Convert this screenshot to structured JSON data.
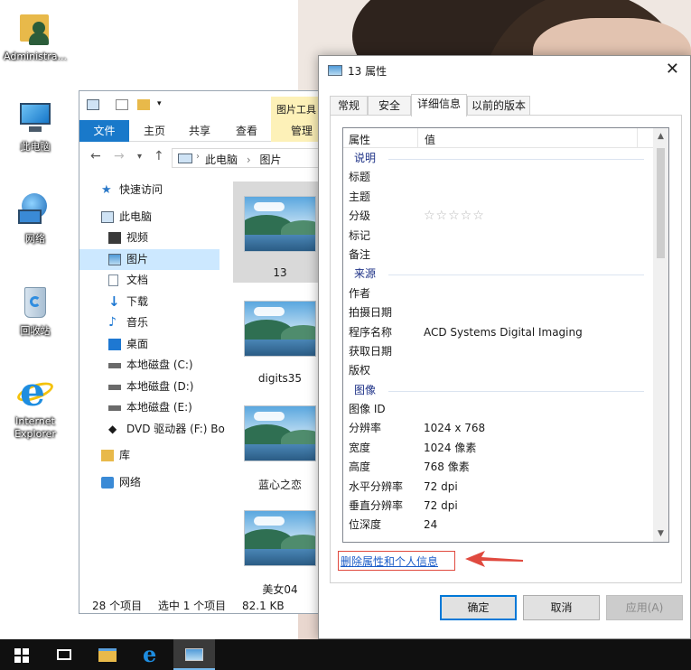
{
  "desktop": {
    "icons": [
      {
        "label": "Administra...",
        "icon": "user-folder-icon"
      },
      {
        "label": "此电脑",
        "icon": "computer-icon"
      },
      {
        "label": "网络",
        "icon": "network-icon"
      },
      {
        "label": "回收站",
        "icon": "recycle-bin-icon"
      },
      {
        "label": "Internet Explorer",
        "icon": "internet-explorer-icon"
      }
    ]
  },
  "explorer": {
    "context_tab": "图片工具",
    "ribbon_tabs": [
      "文件",
      "主页",
      "共享",
      "查看",
      "管理"
    ],
    "breadcrumb": [
      "此电脑",
      "图片"
    ],
    "nav_items": [
      {
        "label": "快速访问",
        "icon": "star-icon"
      },
      {
        "label": "此电脑",
        "icon": "computer-icon"
      },
      {
        "label": "视频",
        "icon": "video-icon"
      },
      {
        "label": "图片",
        "icon": "pictures-icon"
      },
      {
        "label": "文档",
        "icon": "document-icon"
      },
      {
        "label": "下载",
        "icon": "download-icon"
      },
      {
        "label": "音乐",
        "icon": "music-icon"
      },
      {
        "label": "桌面",
        "icon": "desktop-icon"
      },
      {
        "label": "本地磁盘 (C:)",
        "icon": "drive-icon"
      },
      {
        "label": "本地磁盘 (D:)",
        "icon": "drive-icon"
      },
      {
        "label": "本地磁盘 (E:)",
        "icon": "drive-icon"
      },
      {
        "label": "DVD 驱动器 (F:) Bo",
        "icon": "dvd-icon"
      },
      {
        "label": "库",
        "icon": "library-icon"
      },
      {
        "label": "网络",
        "icon": "network-icon"
      }
    ],
    "files": [
      "13",
      "digits35",
      "蓝心之恋",
      "美女04"
    ],
    "status": {
      "count": "28 个项目",
      "selected": "选中 1 个项目",
      "size": "82.1 KB"
    }
  },
  "dialog": {
    "title": "13 属性",
    "tabs": [
      "常规",
      "安全",
      "详细信息",
      "以前的版本"
    ],
    "active_tab": "详细信息",
    "columns": {
      "property": "属性",
      "value": "值"
    },
    "rows": [
      {
        "group": "说明"
      },
      {
        "key": "标题",
        "value": ""
      },
      {
        "key": "主题",
        "value": ""
      },
      {
        "key": "分级",
        "value": "☆☆☆☆☆"
      },
      {
        "key": "标记",
        "value": ""
      },
      {
        "key": "备注",
        "value": ""
      },
      {
        "group": "来源"
      },
      {
        "key": "作者",
        "value": ""
      },
      {
        "key": "拍摄日期",
        "value": ""
      },
      {
        "key": "程序名称",
        "value": "ACD Systems Digital Imaging"
      },
      {
        "key": "获取日期",
        "value": ""
      },
      {
        "key": "版权",
        "value": ""
      },
      {
        "group": "图像"
      },
      {
        "key": "图像 ID",
        "value": ""
      },
      {
        "key": "分辨率",
        "value": "1024 x 768"
      },
      {
        "key": "宽度",
        "value": "1024 像素"
      },
      {
        "key": "高度",
        "value": "768 像素"
      },
      {
        "key": "水平分辨率",
        "value": "72 dpi"
      },
      {
        "key": "垂直分辨率",
        "value": "72 dpi"
      },
      {
        "key": "位深度",
        "value": "24"
      }
    ],
    "remove_link": "删除属性和个人信息",
    "buttons": {
      "ok": "确定",
      "cancel": "取消",
      "apply": "应用(A)"
    }
  },
  "taskbar": {
    "items": [
      "start-icon",
      "task-view-icon",
      "file-explorer-icon",
      "internet-explorer-icon",
      "photos-icon"
    ]
  },
  "colors": {
    "accent": "#1979ca",
    "link": "#1a5cc8",
    "annotation": "#e04a3f"
  }
}
